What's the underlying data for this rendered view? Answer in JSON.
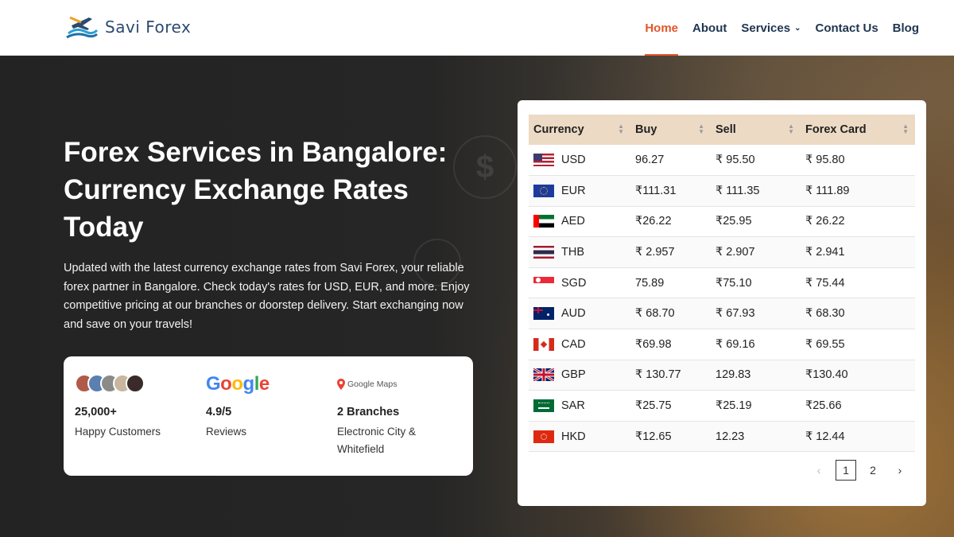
{
  "brand": {
    "name": "Savi Forex"
  },
  "nav": {
    "home": "Home",
    "about": "About",
    "services": "Services",
    "contact": "Contact Us",
    "blog": "Blog"
  },
  "hero": {
    "title": "Forex Services in Bangalore: Currency Exchange Rates Today",
    "description": "Updated with the latest currency exchange rates from Savi Forex, your reliable forex partner in Bangalore. Check today's rates for USD, EUR, and more. Enjoy competitive pricing at our branches or doorstep delivery. Start exchanging now and save on your travels!"
  },
  "stats": {
    "customers": {
      "value": "25,000+",
      "label": "Happy Customers"
    },
    "reviews": {
      "brand": "Google",
      "value": "4.9/5",
      "label": "Reviews"
    },
    "branches": {
      "brand": "Google Maps",
      "value": "2 Branches",
      "label": "Electronic City & Whitefield"
    }
  },
  "rates": {
    "headers": {
      "currency": "Currency",
      "buy": "Buy",
      "sell": "Sell",
      "card": "Forex Card"
    },
    "rows": [
      {
        "code": "USD",
        "buy": "96.27",
        "sell": "₹ 95.50",
        "card": "₹ 95.80"
      },
      {
        "code": "EUR",
        "buy": "₹111.31",
        "sell": "₹ 111.35",
        "card": "₹ 111.89"
      },
      {
        "code": "AED",
        "buy": "₹26.22",
        "sell": "₹25.95",
        "card": "₹ 26.22"
      },
      {
        "code": "THB",
        "buy": "₹ 2.957",
        "sell": "₹ 2.907",
        "card": "₹ 2.941"
      },
      {
        "code": "SGD",
        "buy": "75.89",
        "sell": "₹75.10",
        "card": "₹ 75.44"
      },
      {
        "code": "AUD",
        "buy": "₹ 68.70",
        "sell": "₹ 67.93",
        "card": "₹ 68.30"
      },
      {
        "code": "CAD",
        "buy": "₹69.98",
        "sell": "₹ 69.16",
        "card": "₹ 69.55"
      },
      {
        "code": "GBP",
        "buy": "₹ 130.77",
        "sell": "129.83",
        "card": "₹130.40"
      },
      {
        "code": "SAR",
        "buy": "₹25.75",
        "sell": "₹25.19",
        "card": "₹25.66"
      },
      {
        "code": "HKD",
        "buy": "₹12.65",
        "sell": "12.23",
        "card": "₹ 12.44"
      }
    ],
    "pagination": {
      "prev": "‹",
      "pages": [
        "1",
        "2"
      ],
      "current": "1",
      "next": "›"
    }
  },
  "colors": {
    "accent": "#e2562a",
    "navy": "#1f3550",
    "table_header": "#ecdac4"
  }
}
